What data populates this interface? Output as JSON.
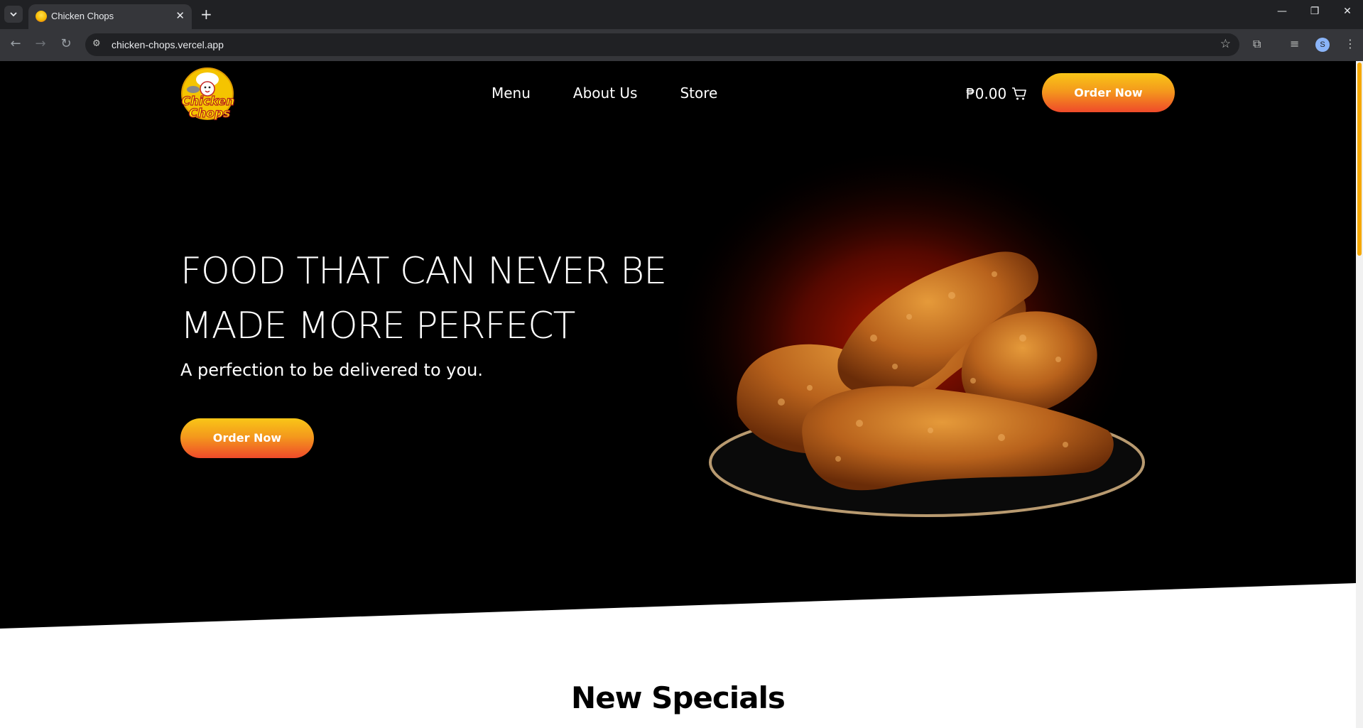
{
  "browser": {
    "tab_title": "Chicken Chops",
    "url": "chicken-chops.vercel.app",
    "profile_initial": "S"
  },
  "header": {
    "logo_text": [
      "Chicken",
      "Chops"
    ],
    "nav": [
      "Menu",
      "About Us",
      "Store"
    ],
    "cart_total": "₱0.00",
    "order_button": "Order Now"
  },
  "hero": {
    "title": "FOOD THAT CAN NEVER BE MADE MORE PERFECT",
    "subtitle": "A perfection to be delivered to you.",
    "order_button": "Order Now"
  },
  "specials": {
    "title": "New Specials"
  },
  "colors": {
    "accent_top": "#f9c617",
    "accent_bottom": "#ef4a2a",
    "background": "#000000"
  }
}
